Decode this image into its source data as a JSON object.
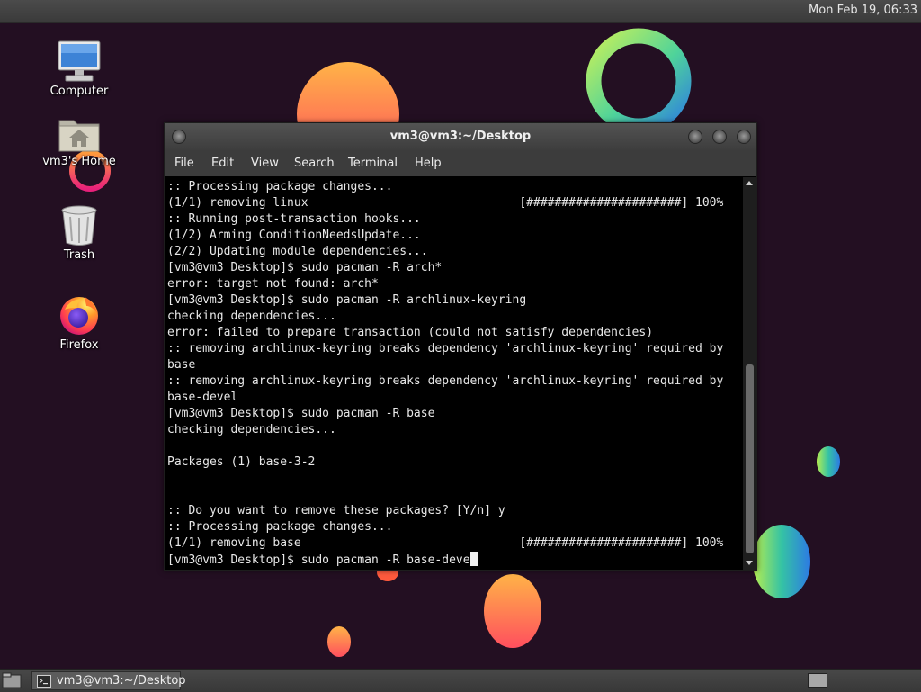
{
  "panel": {
    "clock": "Mon Feb 19, 06:33"
  },
  "desktop_icons": [
    {
      "label": "Computer",
      "icon": "computer-icon"
    },
    {
      "label": "vm3's Home",
      "icon": "home-folder-icon"
    },
    {
      "label": "Trash",
      "icon": "trash-icon"
    },
    {
      "label": "Firefox",
      "icon": "firefox-icon"
    }
  ],
  "terminal": {
    "title": "vm3@vm3:~/Desktop",
    "menu": [
      "File",
      "Edit",
      "View",
      "Search",
      "Terminal",
      "Help"
    ],
    "lines": [
      ":: Processing package changes...",
      "(1/1) removing linux                              [######################] 100%",
      ":: Running post-transaction hooks...",
      "(1/2) Arming ConditionNeedsUpdate...",
      "(2/2) Updating module dependencies...",
      "[vm3@vm3 Desktop]$ sudo pacman -R arch*",
      "error: target not found: arch*",
      "[vm3@vm3 Desktop]$ sudo pacman -R archlinux-keyring",
      "checking dependencies...",
      "error: failed to prepare transaction (could not satisfy dependencies)",
      ":: removing archlinux-keyring breaks dependency 'archlinux-keyring' required by",
      "base",
      ":: removing archlinux-keyring breaks dependency 'archlinux-keyring' required by",
      "base-devel",
      "[vm3@vm3 Desktop]$ sudo pacman -R base",
      "checking dependencies...",
      "",
      "Packages (1) base-3-2",
      "",
      "",
      ":: Do you want to remove these packages? [Y/n] y",
      ":: Processing package changes...",
      "(1/1) removing base                               [######################] 100%"
    ],
    "prompt_line": "[vm3@vm3 Desktop]$ sudo pacman -R base-deve"
  },
  "taskbar": {
    "task_label": "vm3@vm3:~/Desktop"
  },
  "colors": {
    "desktop_bg": "#220e22",
    "terminal_bg": "#000000",
    "terminal_fg": "#e8e8e8"
  }
}
